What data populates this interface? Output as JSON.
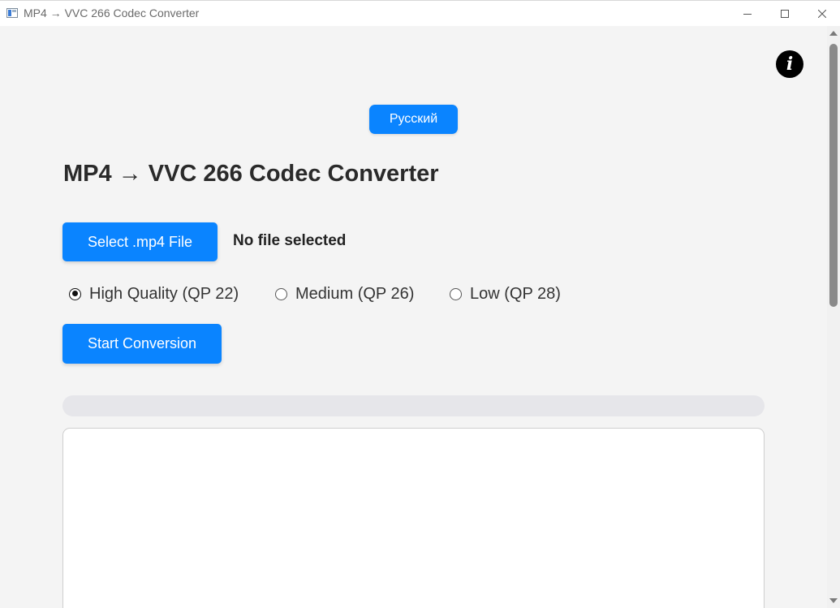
{
  "window": {
    "title": "MP4 → VVC 266 Codec Converter"
  },
  "header": {
    "language_button": "Русский",
    "info_icon": "info-icon"
  },
  "main": {
    "title": "MP4 → VVC 266 Codec Converter",
    "select_file_label": "Select .mp4 File",
    "file_status": "No file selected",
    "quality_options": [
      {
        "label": "High Quality (QP 22)",
        "selected": true
      },
      {
        "label": "Medium (QP 26)",
        "selected": false
      },
      {
        "label": "Low (QP 28)",
        "selected": false
      }
    ],
    "start_label": "Start Conversion",
    "progress_percent": 0,
    "log_text": ""
  },
  "colors": {
    "accent": "#0a84ff",
    "background": "#f4f4f4",
    "progress_track": "#e6e6ea"
  }
}
